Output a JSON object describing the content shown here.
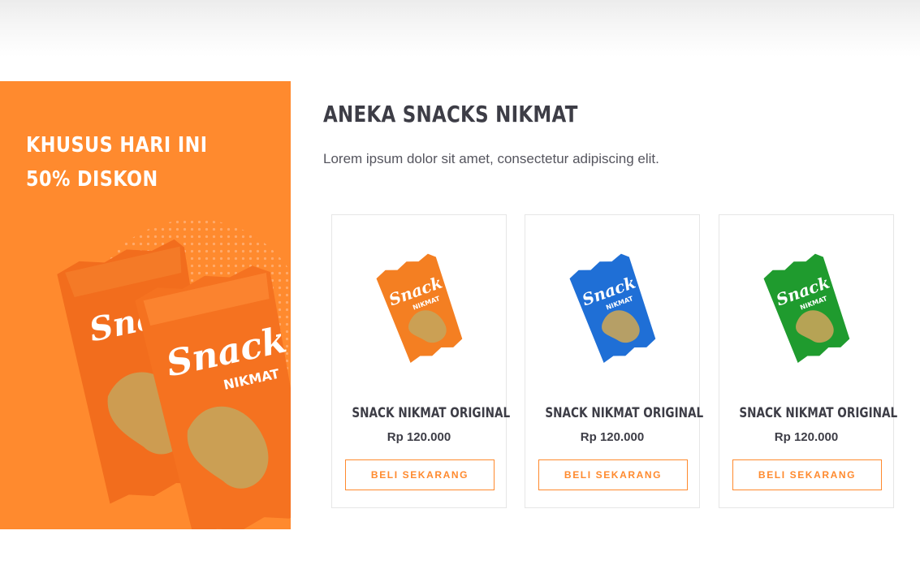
{
  "promo": {
    "line1": "KHUSUS HARI INI",
    "line2": "50% DISKON",
    "background_color": "#ff8a2e",
    "package_brand": "Snack",
    "package_sub": "NIKMAT"
  },
  "section": {
    "title": "ANEKA SNACKS NIKMAT",
    "description": "Lorem ipsum dolor sit amet, consectetur adipiscing elit."
  },
  "products": [
    {
      "name": "SNACK NIKMAT ORIGINAL",
      "price": "Rp 120.000",
      "button": "BELI SEKARANG",
      "package_color": "#f47f22",
      "package_brand": "Snack",
      "package_sub": "NIKMAT"
    },
    {
      "name": "SNACK NIKMAT ORIGINAL",
      "price": "Rp 120.000",
      "button": "BELI SEKARANG",
      "package_color": "#1f6fd6",
      "package_brand": "Snack",
      "package_sub": "NIKMAT"
    },
    {
      "name": "SNACK NIKMAT ORIGINAL",
      "price": "Rp 120.000",
      "button": "BELI SEKARANG",
      "package_color": "#1f9b2e",
      "package_brand": "Snack",
      "package_sub": "NIKMAT"
    }
  ],
  "colors": {
    "accent": "#ff8a2e",
    "heading": "#3d3d46",
    "text": "#55555e",
    "card_border": "#e6e6e6"
  }
}
